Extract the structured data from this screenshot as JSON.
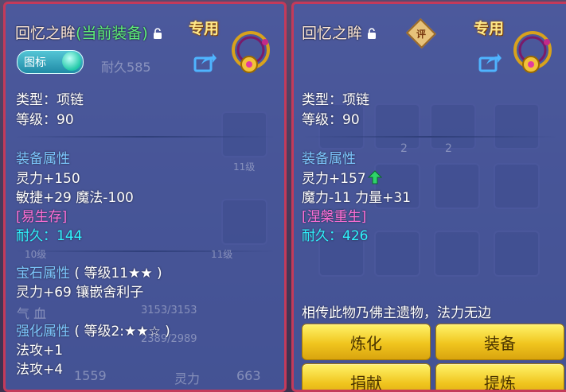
{
  "left_panel": {
    "item_name": "回忆之眸",
    "equipped_tag": "(当前装备)",
    "special_tag": "专用",
    "icon_toggle_label": "图标",
    "type_line": "类型：项链",
    "level_line": "等级：90",
    "attr_header": "装备属性",
    "attr_lines": [
      "灵力+150",
      "敏捷+29 魔法-100"
    ],
    "special_effect": "[易生存]",
    "durability": "耐久：144",
    "gem_header": "宝石属性",
    "gem_level": "( 等级11★★ )",
    "gem_line": "灵力+69 镶嵌舍利子",
    "enhance_header": "强化属性",
    "enhance_level": "( 等级2:★★☆ )",
    "enhance_lines": [
      "法攻+1",
      "法攻+4"
    ]
  },
  "right_panel": {
    "item_name": "回忆之眸",
    "rate_label": "评",
    "special_tag": "专用",
    "type_line": "类型：项链",
    "level_line": "等级：90",
    "attr_header": "装备属性",
    "attr_line_1": "灵力+157",
    "attr_line_2": "魔力-11 力量+31",
    "special_effect": "[涅槃重生]",
    "durability": "耐久：426",
    "description": "相传此物乃佛主遗物，法力无边",
    "buttons": [
      "炼化",
      "装备",
      "捐献",
      "提炼"
    ]
  },
  "background_text": {
    "durability_label": "耐久",
    "durability_value": "585",
    "slot_level_1": "11级",
    "slot_level_2": "11级",
    "slot_level_3": "10级",
    "slot_count_1": "2",
    "slot_count_2": "2",
    "hp_label": "气 血",
    "hp_value": "3153/3153",
    "mp_value": "2389/2989",
    "stat_value": "1559",
    "spirit_label": "灵力",
    "spirit_value": "663"
  },
  "colors": {
    "panel_border": "#c43a5a",
    "current_equip": "#5ff07a",
    "header_blue": "#7cc7ff",
    "special_pink": "#ff6fd8",
    "durability_cyan": "#2ff4ff",
    "button_gold": "#f0c51e"
  }
}
